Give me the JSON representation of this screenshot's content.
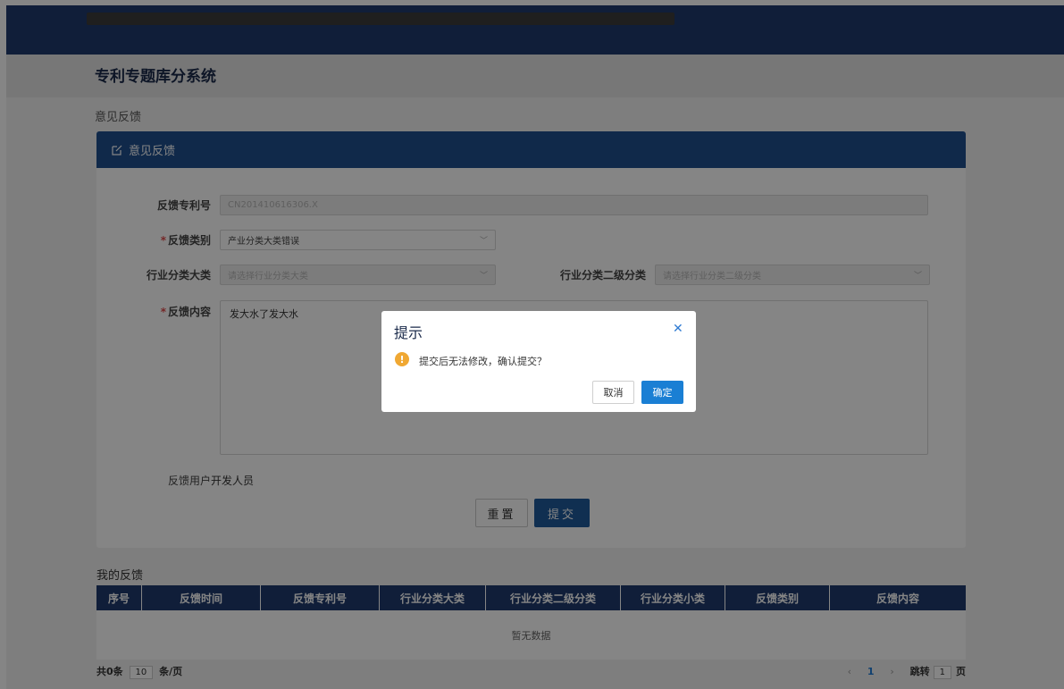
{
  "app": {
    "title": "专利专题库分系统"
  },
  "breadcrumb": "意见反馈",
  "panel": {
    "title": "意见反馈",
    "fields": {
      "patent_no": {
        "label": "反馈专利号",
        "value": "CN201410616306.X"
      },
      "category": {
        "label": "反馈类别",
        "value": "产业分类大类错误"
      },
      "industry_major": {
        "label": "行业分类大类",
        "placeholder": "请选择行业分类大类"
      },
      "industry_secondary": {
        "label": "行业分类二级分类",
        "placeholder": "请选择行业分类二级分类"
      },
      "content": {
        "label": "反馈内容",
        "value": "发大水了发大水"
      },
      "user": {
        "label": "反馈用户",
        "value": "开发人员"
      }
    },
    "buttons": {
      "reset": "重置",
      "submit": "提交"
    }
  },
  "my_feedback": {
    "title": "我的反馈",
    "columns": [
      "序号",
      "反馈时间",
      "反馈专利号",
      "行业分类大类",
      "行业分类二级分类",
      "行业分类小类",
      "反馈类别",
      "反馈内容"
    ],
    "empty_text": "暂无数据"
  },
  "pager": {
    "total": "共0条",
    "page_size": "10",
    "per_page_suffix": "条/页",
    "current_page": "1",
    "jump_label": "跳转",
    "jump_value": "1",
    "page_suffix": "页"
  },
  "dialog": {
    "title": "提示",
    "message": "提交后无法修改，确认提交？",
    "cancel": "取消",
    "ok": "确定"
  },
  "colors": {
    "header": "#1f3b6e",
    "panel_header": "#1f4f8f",
    "primary": "#1a7fd4",
    "warning": "#f0a833"
  }
}
